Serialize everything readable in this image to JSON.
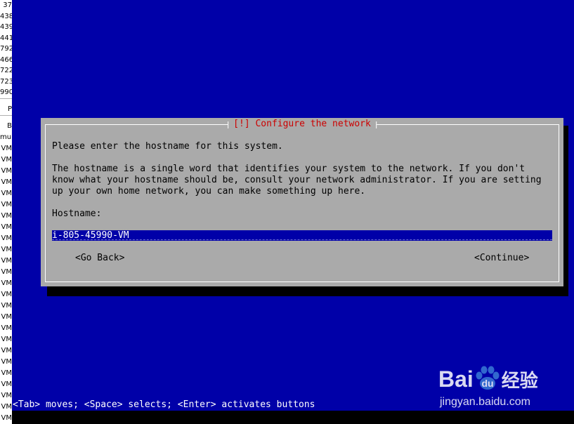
{
  "left_strip": {
    "lines": [
      "37",
      "438",
      "439",
      "441",
      "792",
      "466",
      "722",
      "723",
      "990",
      "P",
      "B",
      "mur",
      "VM",
      "VM",
      "VM",
      "VM",
      "VM",
      "VM",
      "VM",
      "VM",
      "VM",
      "VM",
      "VM",
      "VM",
      "VM",
      "VM",
      "VM",
      "VM",
      "VM",
      "VM",
      "VM",
      "VM",
      "VM",
      "VM",
      "VM",
      "VM",
      "VM",
      "..."
    ]
  },
  "dialog": {
    "title": "[!] Configure the network",
    "intro": "Please enter the hostname for this system.",
    "explanation_lines": [
      "The hostname is a single word that identifies your system to the network. If you don't",
      "know what your hostname should be, consult your network administrator. If you are setting",
      "up your own home network, you can make something up here."
    ],
    "hostname_label": "Hostname:",
    "hostname_value": "i-805-45990-VM",
    "back_button": "<Go Back>",
    "continue_button": "<Continue>"
  },
  "status_bar": "<Tab> moves; <Space> selects; <Enter> activates buttons",
  "watermark": {
    "brand": "Bai",
    "brand_suffix": "经验",
    "url": "jingyan.baidu.com"
  },
  "colors": {
    "screen_bg": "#0000a8",
    "dialog_bg": "#aaaaaa",
    "title_color": "#cc0000",
    "field_bg": "#0000a8"
  }
}
